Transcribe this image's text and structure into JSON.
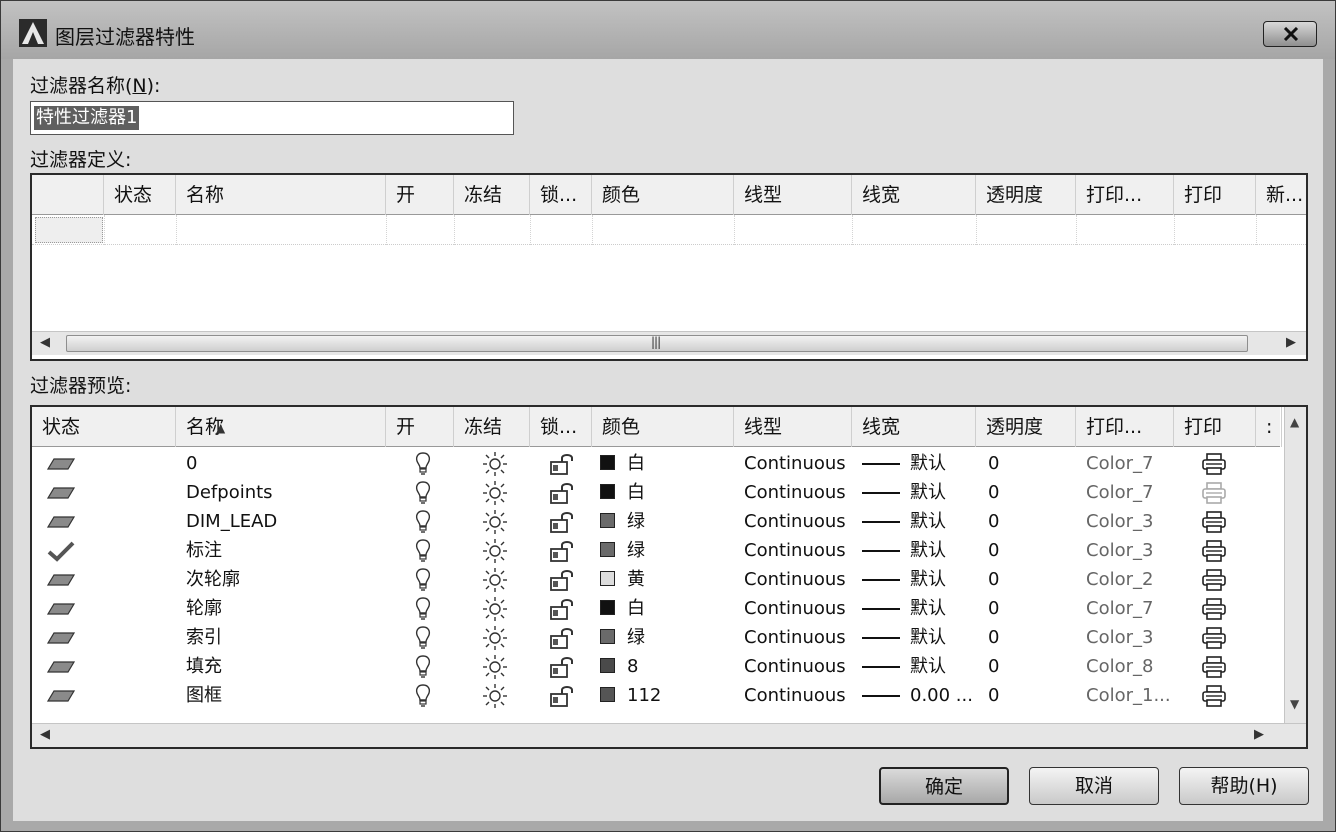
{
  "window": {
    "title": "图层过滤器特性"
  },
  "filter_name": {
    "label_prefix": "过滤器名称(",
    "label_key": "N",
    "label_suffix": "):",
    "value": "特性过滤器1"
  },
  "definition": {
    "label": "过滤器定义:",
    "columns": [
      "",
      "状态",
      "名称",
      "开",
      "冻结",
      "锁...",
      "颜色",
      "线型",
      "线宽",
      "透明度",
      "打印...",
      "打印",
      "新..."
    ]
  },
  "preview": {
    "label": "过滤器预览:",
    "columns": [
      "状态",
      "名称",
      "开",
      "冻结",
      "锁...",
      "颜色",
      "线型",
      "线宽",
      "透明度",
      "打印...",
      "打印",
      ":"
    ],
    "rows": [
      {
        "status": "layer-icon",
        "name": "0",
        "color_hex": "#111111",
        "color": "白",
        "linetype": "Continuous",
        "lineweight": "默认",
        "transparency": "0",
        "plot_style": "Color_7",
        "plot": "printer-icon"
      },
      {
        "status": "layer-icon",
        "name": "Defpoints",
        "color_hex": "#111111",
        "color": "白",
        "linetype": "Continuous",
        "lineweight": "默认",
        "transparency": "0",
        "plot_style": "Color_7",
        "plot": "printer-disabled-icon"
      },
      {
        "status": "layer-icon",
        "name": "DIM_LEAD",
        "color_hex": "#6a6a6a",
        "color": "绿",
        "linetype": "Continuous",
        "lineweight": "默认",
        "transparency": "0",
        "plot_style": "Color_3",
        "plot": "printer-icon"
      },
      {
        "status": "current-check-icon",
        "name": "标注",
        "color_hex": "#6a6a6a",
        "color": "绿",
        "linetype": "Continuous",
        "lineweight": "默认",
        "transparency": "0",
        "plot_style": "Color_3",
        "plot": "printer-icon"
      },
      {
        "status": "layer-icon",
        "name": "次轮廓",
        "color_hex": "#dddddd",
        "color": "黄",
        "linetype": "Continuous",
        "lineweight": "默认",
        "transparency": "0",
        "plot_style": "Color_2",
        "plot": "printer-icon"
      },
      {
        "status": "layer-icon",
        "name": "轮廓",
        "color_hex": "#111111",
        "color": "白",
        "linetype": "Continuous",
        "lineweight": "默认",
        "transparency": "0",
        "plot_style": "Color_7",
        "plot": "printer-icon"
      },
      {
        "status": "layer-icon",
        "name": "索引",
        "color_hex": "#6a6a6a",
        "color": "绿",
        "linetype": "Continuous",
        "lineweight": "默认",
        "transparency": "0",
        "plot_style": "Color_3",
        "plot": "printer-icon"
      },
      {
        "status": "layer-icon",
        "name": "填充",
        "color_hex": "#4a4a4a",
        "color": "8",
        "linetype": "Continuous",
        "lineweight": "默认",
        "transparency": "0",
        "plot_style": "Color_8",
        "plot": "printer-icon"
      },
      {
        "status": "layer-icon",
        "name": "图框",
        "color_hex": "#555555",
        "color": "112",
        "linetype": "Continuous",
        "lineweight": "0.00 ...",
        "transparency": "0",
        "plot_style": "Color_1...",
        "plot": "printer-icon"
      }
    ]
  },
  "buttons": {
    "ok": "确定",
    "cancel": "取消",
    "help": "帮助(H)"
  }
}
